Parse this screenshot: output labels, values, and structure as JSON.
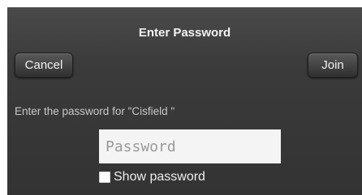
{
  "dialog": {
    "title": "Enter Password",
    "cancel_label": "Cancel",
    "join_label": "Join",
    "prompt": "Enter the password for \"Cisfield \"",
    "password_placeholder": "Password",
    "password_value": "",
    "show_password_label": "Show password",
    "show_password_checked": false
  }
}
